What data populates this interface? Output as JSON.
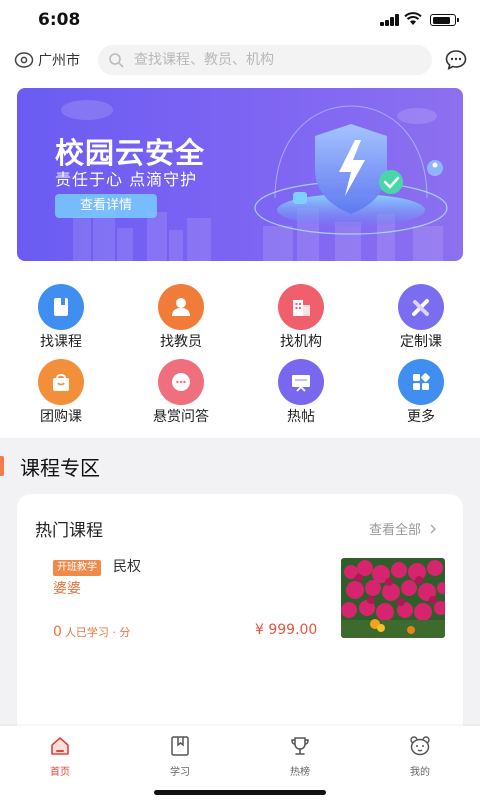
{
  "status_bar": {
    "time": "6:08"
  },
  "header": {
    "location": "广州市",
    "search_placeholder": "查找课程、教员、机构"
  },
  "banner": {
    "title": "校园云安全",
    "subtitle": "责任于心 点滴守护",
    "button_label": "查看详情"
  },
  "quick_menu": {
    "items": [
      {
        "label": "找课程",
        "icon": "book-icon",
        "color": "#3f8ef0"
      },
      {
        "label": "找教员",
        "icon": "teacher-icon",
        "color": "#f17c3a"
      },
      {
        "label": "找机构",
        "icon": "building-icon",
        "color": "#ef5f6c"
      },
      {
        "label": "定制课",
        "icon": "customize-icon",
        "color": "#7b6df0"
      },
      {
        "label": "团购课",
        "icon": "shopping-bag-icon",
        "color": "#f18f3a"
      },
      {
        "label": "悬赏问答",
        "icon": "chat-bubble-icon",
        "color": "#ef6f7f"
      },
      {
        "label": "热帖",
        "icon": "board-icon",
        "color": "#7a67ef"
      },
      {
        "label": "更多",
        "icon": "grid-icon",
        "color": "#3f8ef0"
      }
    ]
  },
  "course_zone": {
    "section_title": "课程专区",
    "card_title": "热门课程",
    "view_all": "查看全部",
    "course": {
      "tag": "开班教学",
      "name": "民权",
      "teacher": "婆婆",
      "learners_count": "0",
      "learners_text": "人已学习 · 分",
      "price": "¥ 999.00",
      "thumb": "flowers-image"
    }
  },
  "tab_bar": {
    "items": [
      {
        "label": "首页",
        "icon": "home-icon",
        "active": true
      },
      {
        "label": "学习",
        "icon": "study-book-icon",
        "active": false
      },
      {
        "label": "热榜",
        "icon": "trophy-icon",
        "active": false
      },
      {
        "label": "我的",
        "icon": "profile-bear-icon",
        "active": false
      }
    ]
  },
  "colors": {
    "accent_orange": "#e8743f",
    "price_red": "#e8543f",
    "active_tab_red": "#e1443a",
    "banner_purple": "#6a5cf2"
  }
}
